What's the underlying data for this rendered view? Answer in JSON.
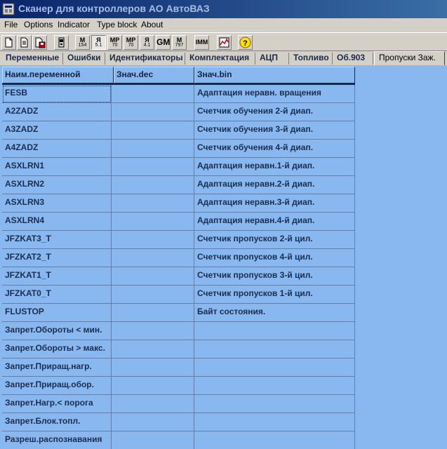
{
  "window": {
    "title": "Сканер для контроллеров АО АвтоВАЗ",
    "icon": "app-window-icon"
  },
  "menu": [
    "File",
    "Options",
    "Indicator",
    "Type block",
    "About"
  ],
  "toolbar": {
    "buttons": [
      {
        "icon": "new-document-icon"
      },
      {
        "icon": "open-document-icon"
      },
      {
        "icon": "save-document-icon"
      },
      {
        "icon": "device-icon"
      },
      {
        "icon": "ecu-m154-icon",
        "label1": "M",
        "label2": "154"
      },
      {
        "icon": "ecu-ya51-icon",
        "label1": "Я",
        "label2": "5.1",
        "pressed": true
      },
      {
        "icon": "ecu-mp70-icon",
        "label1": "MP",
        "label2": "70"
      },
      {
        "icon": "ecu-mp70-b-icon",
        "label1": "MP",
        "label2": "70"
      },
      {
        "icon": "ecu-ya41-icon",
        "label1": "Я",
        "label2": "4.1"
      },
      {
        "icon": "ecu-gm-icon",
        "label1": "GM",
        "label2": ""
      },
      {
        "icon": "ecu-m797-icon",
        "label1": "M",
        "label2": "797"
      },
      {
        "icon": "immo-icon",
        "label1": "IMM",
        "label2": ""
      },
      {
        "icon": "chart-icon"
      },
      {
        "icon": "help-icon",
        "label1": "?",
        "label2": ""
      }
    ]
  },
  "tabs": [
    "Переменные",
    "Ошибки",
    "Идентификаторы",
    "Комплектация",
    "АЦП",
    "Топливо",
    "Об.903",
    "Пропуски Заж."
  ],
  "active_tab": "Пропуски Заж.",
  "table": {
    "columns": [
      "Наим.переменной",
      "Знач.dec",
      "Знач.bin"
    ],
    "rows": [
      [
        "FESB",
        "",
        "Адаптация неравн. вращения"
      ],
      [
        "A2ZADZ",
        "",
        "Счетчик обучения 2-й диап."
      ],
      [
        "A3ZADZ",
        "",
        "Счетчик обучения 3-й диап."
      ],
      [
        "A4ZADZ",
        "",
        "Счетчик обучения 4-й диап."
      ],
      [
        "ASXLRN1",
        "",
        "Адаптация неравн.1-й диап."
      ],
      [
        "ASXLRN2",
        "",
        "Адаптация неравн.2-й диап."
      ],
      [
        "ASXLRN3",
        "",
        "Адаптация неравн.3-й диап."
      ],
      [
        "ASXLRN4",
        "",
        "Адаптация неравн.4-й диап."
      ],
      [
        "JFZKAT3_T",
        "",
        "Счетчик пропусков 2-й цил."
      ],
      [
        "JFZKAT2_T",
        "",
        "Счетчик пропусков 4-й цил."
      ],
      [
        "JFZKAT1_T",
        "",
        "Счетчик пропусков 3-й цил."
      ],
      [
        "JFZKAT0_T",
        "",
        "Счетчик пропусков 1-й цил."
      ],
      [
        "FLUSTOP",
        "",
        "Байт состояния."
      ],
      [
        "Запрет.Обороты < мин.",
        "",
        ""
      ],
      [
        "Запрет.Обороты > макс.",
        "",
        ""
      ],
      [
        "Запрет.Приращ.нагр.",
        "",
        ""
      ],
      [
        "Запрет.Приращ.обор.",
        "",
        ""
      ],
      [
        "Запрет.Нагр.< порога",
        "",
        ""
      ],
      [
        "Запрет.Блок.топл.",
        "",
        ""
      ],
      [
        "Разреш.распознавания",
        "",
        ""
      ]
    ]
  },
  "colors": {
    "grid_bg": "#89b8f0",
    "title_bar": "#0a246a",
    "text": "#1b2d4f"
  }
}
